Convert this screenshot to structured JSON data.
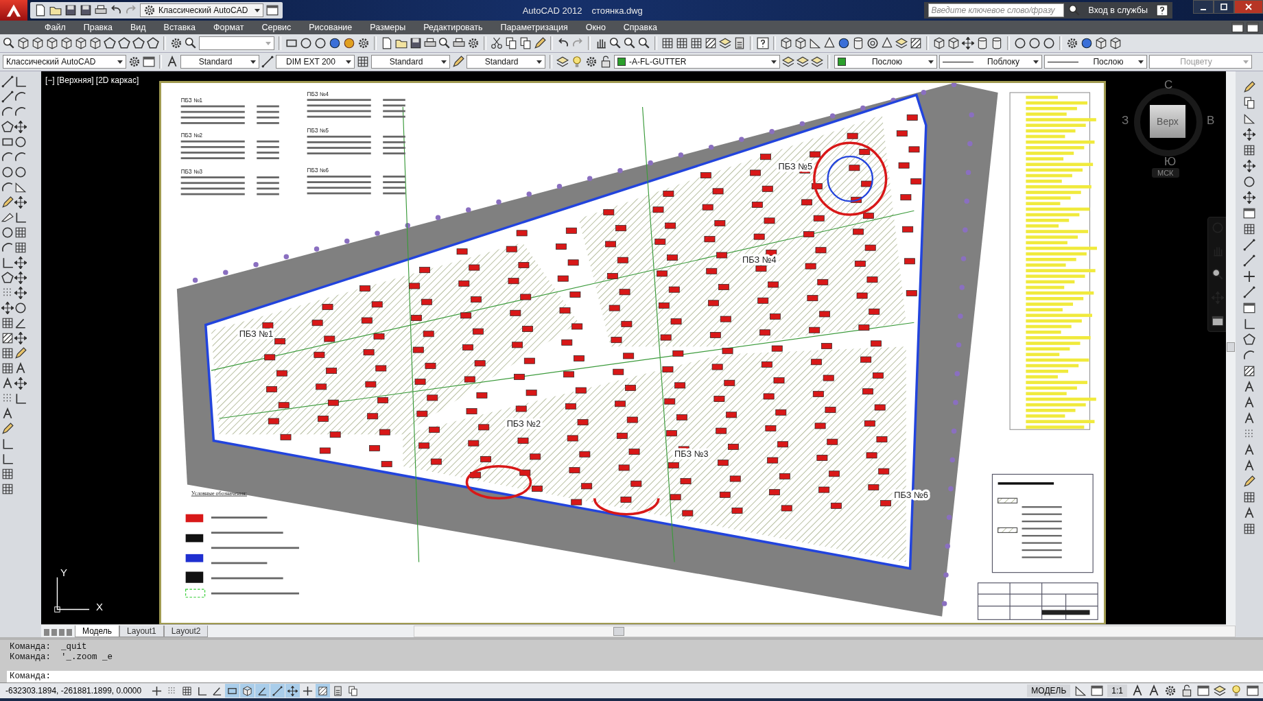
{
  "title_bar": {
    "workspace": "Классический AutoCAD",
    "app": "AutoCAD 2012",
    "file": "стоянка.dwg",
    "search": {
      "placeholder": "Введите ключевое слово/фразу"
    },
    "sign_in": "Вход в службы"
  },
  "menu": [
    "Файл",
    "Правка",
    "Вид",
    "Вставка",
    "Формат",
    "Сервис",
    "Рисование",
    "Размеры",
    "Редактировать",
    "Параметризация",
    "Окно",
    "Справка"
  ],
  "properties_bar": [
    {
      "kind": "workspace",
      "value": "Классический AutoCAD",
      "disabled": false
    },
    {
      "kind": "text-style",
      "value": "Standard",
      "disabled": false
    },
    {
      "kind": "dim-style",
      "value": "DIM EXT 200",
      "disabled": false
    },
    {
      "kind": "table-style",
      "value": "Standard",
      "disabled": false
    },
    {
      "kind": "multileader-style",
      "value": "Standard",
      "disabled": false
    },
    {
      "kind": "layer",
      "value": "-A-FL-GUTTER",
      "color": "#2ca02c",
      "disabled": false
    },
    {
      "kind": "color",
      "value": "Послою",
      "color": "#2ca02c",
      "disabled": false
    },
    {
      "kind": "linetype",
      "value": "Поблоку",
      "disabled": false
    },
    {
      "kind": "linetype",
      "value": "Послою",
      "disabled": false
    },
    {
      "kind": "plot-style",
      "value": "Поцвету",
      "disabled": true
    }
  ],
  "viewport": {
    "label": "[−] [Верхняя] [2D каркас]"
  },
  "viewcube": {
    "north": "С",
    "west": "З",
    "east": "В",
    "south": "Ю",
    "face": "Верх",
    "ucs": "МСК"
  },
  "drawing": {
    "note_headings": [
      "ПБЗ №1",
      "ПБЗ №2",
      "ПБЗ №3",
      "ПБЗ №4",
      "ПБЗ №5",
      "ПБЗ №6"
    ],
    "zones": [
      "ПБЗ №1",
      "ПБЗ №2",
      "ПБЗ №3",
      "ПБЗ №4",
      "ПБЗ №5",
      "ПБЗ №6"
    ],
    "legend_title": "Условные обозначения:"
  },
  "ucs_icon": {
    "x": "X",
    "y": "Y"
  },
  "layout_tabs": [
    {
      "label": "Модель",
      "selected": true
    },
    {
      "label": "Layout1",
      "selected": false
    },
    {
      "label": "Layout2",
      "selected": false
    }
  ],
  "command_line": {
    "history": [
      "Команда:  _quit",
      "Команда:  '_.zoom _e"
    ],
    "prompt": "Команда:"
  },
  "status_bar": {
    "coordinates": "-632303.1894, -261881.1899, 0.0000",
    "toggles": [
      {
        "on": false
      },
      {
        "on": false
      },
      {
        "on": false
      },
      {
        "on": false
      },
      {
        "on": false
      },
      {
        "on": true
      },
      {
        "on": true
      },
      {
        "on": true
      },
      {
        "on": true
      },
      {
        "on": true
      },
      {
        "on": false
      },
      {
        "on": true
      },
      {
        "on": false
      },
      {
        "on": false
      }
    ],
    "space": "МОДЕЛЬ",
    "scale": "1:1"
  }
}
